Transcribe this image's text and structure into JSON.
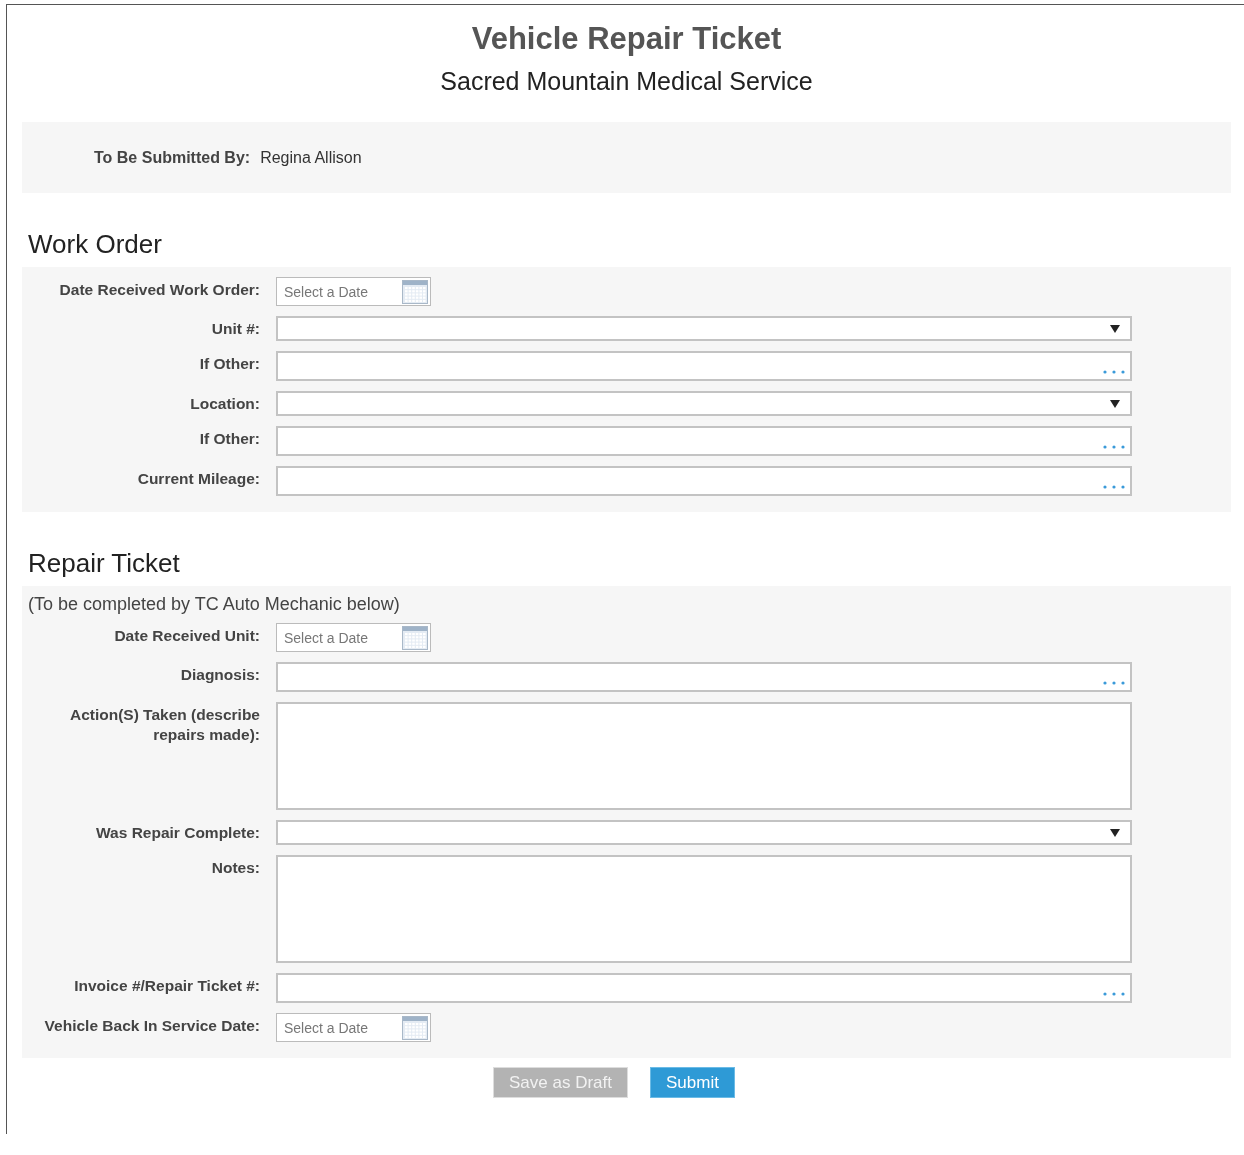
{
  "header": {
    "title": "Vehicle Repair Ticket",
    "subtitle": "Sacred Mountain Medical Service"
  },
  "submitter": {
    "label": "To Be Submitted By:",
    "value": "Regina Allison"
  },
  "sections": [
    {
      "title": "Work Order",
      "fields": [
        {
          "label": "Date Received Work Order:",
          "kind": "date",
          "placeholder": "Select a Date"
        },
        {
          "label": "Unit #:",
          "kind": "select"
        },
        {
          "label": "If Other:",
          "kind": "text"
        },
        {
          "label": "Location:",
          "kind": "select"
        },
        {
          "label": "If Other:",
          "kind": "text"
        },
        {
          "label": "Current Mileage:",
          "kind": "text"
        }
      ]
    },
    {
      "title": "Repair Ticket",
      "note": "(To be completed by TC Auto Mechanic below)",
      "fields": [
        {
          "label": "Date Received Unit:",
          "kind": "date",
          "placeholder": "Select a Date"
        },
        {
          "label": "Diagnosis:",
          "kind": "text"
        },
        {
          "label": "Action(S) Taken (describe repairs made):",
          "kind": "textarea"
        },
        {
          "label": "Was Repair Complete:",
          "kind": "select"
        },
        {
          "label": "Notes:",
          "kind": "textarea"
        },
        {
          "label": "Invoice #/Repair Ticket #:",
          "kind": "text"
        },
        {
          "label": "Vehicle Back In Service Date:",
          "kind": "date",
          "placeholder": "Select a Date"
        }
      ]
    }
  ],
  "buttons": [
    {
      "label": "Save as Draft",
      "kind": "secondary"
    },
    {
      "label": "Submit",
      "kind": "primary"
    }
  ]
}
